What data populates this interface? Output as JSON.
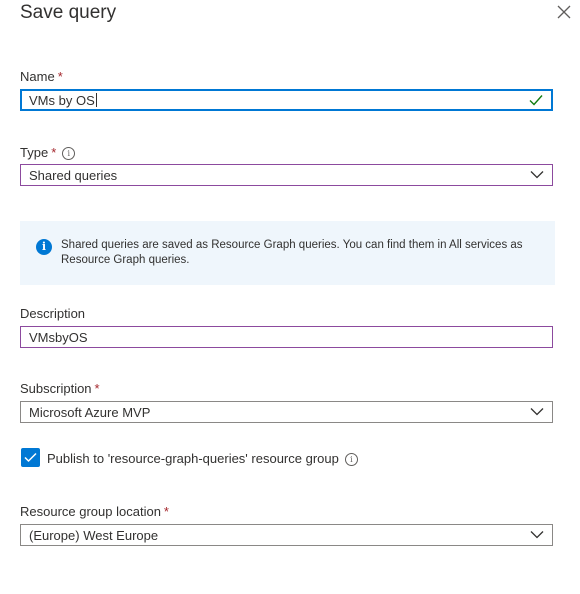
{
  "panel": {
    "title": "Save query"
  },
  "name_field": {
    "label": "Name",
    "required_mark": "*",
    "value": "VMs by OS"
  },
  "type_field": {
    "label": "Type",
    "required_mark": "*",
    "value": "Shared queries"
  },
  "info": {
    "icon": "info-circle-icon",
    "text": "Shared queries are saved as Resource Graph queries. You can find them in All services as Resource Graph queries."
  },
  "description_field": {
    "label": "Description",
    "value": "VMsbyOS"
  },
  "subscription_field": {
    "label": "Subscription",
    "required_mark": "*",
    "value": "Microsoft Azure MVP"
  },
  "publish": {
    "checked": true,
    "label": "Publish to 'resource-graph-queries' resource group"
  },
  "location_field": {
    "label": "Resource group location",
    "required_mark": "*",
    "value": "(Europe) West Europe"
  },
  "colors": {
    "accent": "#0078d4",
    "required": "#a4262c",
    "valid_check": "#107c10",
    "focus_purple": "#8c4a9e",
    "info_background": "#eff6fc"
  }
}
